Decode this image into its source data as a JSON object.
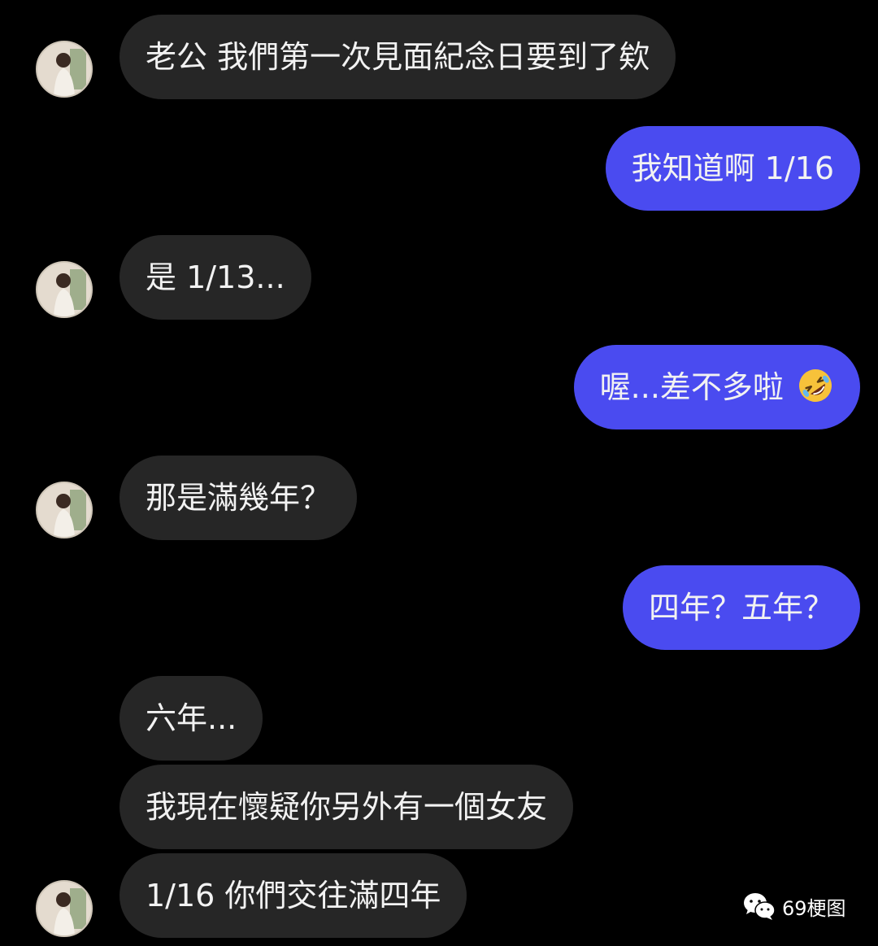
{
  "messages": [
    {
      "side": "in",
      "text": "老公 我們第一次見面紀念日要到了欸"
    },
    {
      "side": "out",
      "text": "我知道啊 1/16"
    },
    {
      "side": "in",
      "text": "是 1/13..."
    },
    {
      "side": "out",
      "text": "喔...差不多啦",
      "emoji": "rolling-on-floor-laughing-emoji"
    },
    {
      "side": "in",
      "text": "那是滿幾年？"
    },
    {
      "side": "out",
      "text": "四年？五年？"
    },
    {
      "side": "in",
      "text": "六年..."
    },
    {
      "side": "in",
      "text": "我現在懷疑你另外有一個女友"
    },
    {
      "side": "in",
      "text": "1/16 你們交往滿四年"
    }
  ],
  "watermark": {
    "icon": "wechat-icon",
    "text": "69梗图"
  },
  "colors": {
    "background": "#000000",
    "incoming_bubble": "#262626",
    "outgoing_bubble": "#4a4bf0",
    "text": "#f2f2f2"
  }
}
